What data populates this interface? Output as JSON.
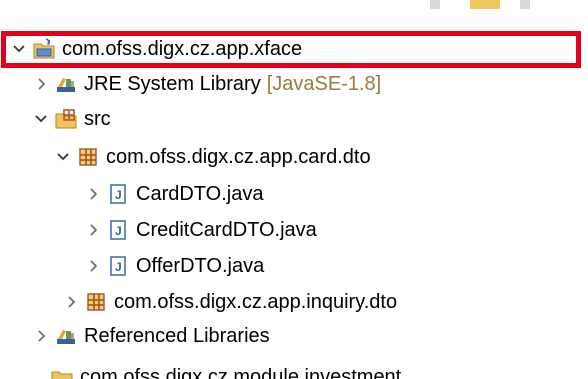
{
  "tree": {
    "project": {
      "label": "com.ofss.digx.cz.app.xface",
      "expanded": true
    },
    "items": [
      {
        "label": "JRE System Library",
        "decoration": "[JavaSE-1.8]",
        "icon": "library-icon",
        "expanded": false
      },
      {
        "label": "src",
        "icon": "source-folder-icon",
        "expanded": true
      },
      {
        "label": "com.ofss.digx.cz.app.card.dto",
        "icon": "package-icon",
        "expanded": true
      },
      {
        "label": "CardDTO.java",
        "icon": "java-file-icon",
        "expanded": false
      },
      {
        "label": "CreditCardDTO.java",
        "icon": "java-file-icon",
        "expanded": false
      },
      {
        "label": "OfferDTO.java",
        "icon": "java-file-icon",
        "expanded": false
      },
      {
        "label": "com.ofss.digx.cz.app.inquiry.dto",
        "icon": "package-icon",
        "expanded": false
      },
      {
        "label": "Referenced Libraries",
        "icon": "library-icon",
        "expanded": false
      }
    ],
    "next_project_partial": "com.ofss.digx.cz.module.investment"
  },
  "colors": {
    "highlight": "#e3001b",
    "decoration": "#9a7a3f"
  }
}
